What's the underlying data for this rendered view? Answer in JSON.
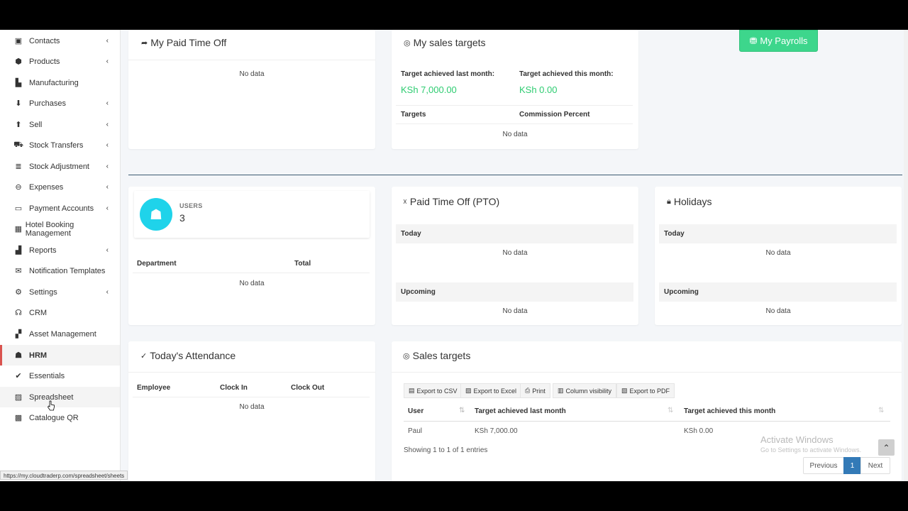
{
  "sidebar": {
    "items": [
      {
        "label": "Contacts",
        "icon": "address-book-icon",
        "glyph": "▣",
        "chevron": true
      },
      {
        "label": "Products",
        "icon": "cubes-icon",
        "glyph": "⬢",
        "chevron": true
      },
      {
        "label": "Manufacturing",
        "icon": "industry-icon",
        "glyph": "▙",
        "chevron": false
      },
      {
        "label": "Purchases",
        "icon": "arrow-circle-down-icon",
        "glyph": "⬇",
        "chevron": true
      },
      {
        "label": "Sell",
        "icon": "arrow-circle-up-icon",
        "glyph": "⬆",
        "chevron": true
      },
      {
        "label": "Stock Transfers",
        "icon": "truck-icon",
        "glyph": "⛟",
        "chevron": true
      },
      {
        "label": "Stock Adjustment",
        "icon": "database-icon",
        "glyph": "≣",
        "chevron": true
      },
      {
        "label": "Expenses",
        "icon": "minus-circle-icon",
        "glyph": "⊖",
        "chevron": true
      },
      {
        "label": "Payment Accounts",
        "icon": "money-bill-icon",
        "glyph": "▭",
        "chevron": true
      },
      {
        "label": "Hotel Booking Management",
        "icon": "hotel-icon",
        "glyph": "▦",
        "chevron": false
      },
      {
        "label": "Reports",
        "icon": "chart-bar-icon",
        "glyph": "▟",
        "chevron": true
      },
      {
        "label": "Notification Templates",
        "icon": "envelope-icon",
        "glyph": "✉",
        "chevron": false
      },
      {
        "label": "Settings",
        "icon": "cog-icon",
        "glyph": "⚙",
        "chevron": true
      },
      {
        "label": "CRM",
        "icon": "broadcast-tower-icon",
        "glyph": "☊",
        "chevron": false
      },
      {
        "label": "Asset Management",
        "icon": "boxes-icon",
        "glyph": "▞",
        "chevron": false
      },
      {
        "label": "HRM",
        "icon": "users-icon",
        "glyph": "☗",
        "chevron": false
      },
      {
        "label": "Essentials",
        "icon": "check-circle-icon",
        "glyph": "✔",
        "chevron": false
      },
      {
        "label": "Spreadsheet",
        "icon": "file-excel-icon",
        "glyph": "▨",
        "chevron": false
      },
      {
        "label": "Catalogue QR",
        "icon": "qrcode-icon",
        "glyph": "▩",
        "chevron": false
      }
    ]
  },
  "status_url": "https://my.cloudtraderp.com/spreadsheet/sheets",
  "payroll_button": "My Payrolls",
  "paid_time_off": {
    "title": "My Paid Time Off",
    "no_data": "No data"
  },
  "my_sales_targets": {
    "title": "My sales targets",
    "last_month_label": "Target achieved last month:",
    "last_month_value": "KSh 7,000.00",
    "this_month_label": "Target achieved this month:",
    "this_month_value": "KSh 0.00",
    "col_targets": "Targets",
    "col_commission": "Commission Percent",
    "no_data": "No data"
  },
  "users_card": {
    "label": "USERS",
    "count": "3",
    "col_department": "Department",
    "col_total": "Total",
    "no_data": "No data"
  },
  "pto": {
    "title": "Paid Time Off (PTO)",
    "today": "Today",
    "today_no_data": "No data",
    "upcoming": "Upcoming",
    "upcoming_no_data": "No data"
  },
  "holidays": {
    "title": "Holidays",
    "today": "Today",
    "today_no_data": "No data",
    "upcoming": "Upcoming",
    "upcoming_no_data": "No data"
  },
  "attendance": {
    "title": "Today's Attendance",
    "col_employee": "Employee",
    "col_clock_in": "Clock In",
    "col_clock_out": "Clock Out",
    "no_data": "No data"
  },
  "sales_targets": {
    "title": "Sales targets",
    "buttons": [
      "Export to CSV",
      "Export to Excel",
      "Print",
      "Column visibility",
      "Export to PDF"
    ],
    "columns": [
      "User",
      "Target achieved last month",
      "Target achieved this month"
    ],
    "rows": [
      [
        "Paul",
        "KSh 7,000.00",
        "KSh 0.00"
      ]
    ],
    "info": "Showing 1 to 1 of 1 entries",
    "pager": {
      "previous": "Previous",
      "current": "1",
      "next": "Next"
    }
  },
  "watermark": {
    "title": "Activate Windows",
    "subtitle": "Go to Settings to activate Windows."
  },
  "colors": {
    "accent_green": "#2ecc71",
    "payroll_green": "#3dd68c",
    "users_icon": "#1fd3ea",
    "pager_active": "#337ab7",
    "hrm_marker": "#d9534f"
  }
}
